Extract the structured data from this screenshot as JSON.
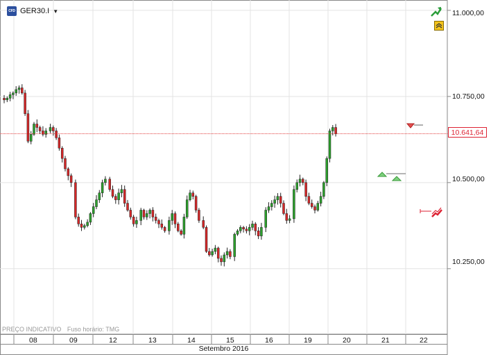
{
  "instrument": {
    "symbol": "GER30.I",
    "logo_text": "CFD",
    "dropdown_icon": "triangle-down-icon"
  },
  "info_bar": {
    "label": "PREÇO INDICATIVO",
    "timezone": "Fuso horário: TMG"
  },
  "current_price": {
    "label": "10.641,64",
    "value": 10641.64,
    "color": "#dd2222"
  },
  "month_label": "Setembro 2016",
  "icons": {
    "top_right": "green-trend-arrow-icon",
    "top_right_2": "yellow-collapse-icon",
    "right_mid": "red-signal-arrow-icon"
  },
  "chart_data": {
    "type": "candlestick",
    "x_tick_labels": [
      "08",
      "09",
      "12",
      "13",
      "14",
      "15",
      "16",
      "19",
      "20",
      "21",
      "22"
    ],
    "y_tick_labels": [
      "11.000,00",
      "10.750,00",
      "10.500,00",
      "10.250,00"
    ],
    "y_ticks": [
      11000,
      10750,
      10500,
      10250
    ],
    "ylim": [
      10060,
      11030
    ],
    "grid": true,
    "legend": "none",
    "up_color": "#2ca02c",
    "down_color": "#d62728",
    "session_closes": [
      [
        10740,
        10745,
        10755,
        10760,
        10770,
        10775,
        10760,
        10700,
        10620,
        10640,
        10670,
        10660,
        10650,
        10640,
        10650
      ],
      [
        10660,
        10650,
        10630,
        10600,
        10570,
        10540,
        10520,
        10500
      ],
      [
        10400,
        10380,
        10370,
        10375,
        10385,
        10410,
        10430,
        10450,
        10470,
        10500,
        10510
      ],
      [
        10480,
        10460,
        10450,
        10470,
        10480,
        10440,
        10420,
        10400,
        10380,
        10390
      ],
      [
        10420,
        10400,
        10410,
        10420,
        10400,
        10390,
        10380,
        10370,
        10360
      ],
      [
        10390,
        10410,
        10380,
        10360,
        10350,
        10400,
        10450,
        10470,
        10460,
        10420,
        10390
      ],
      [
        10370,
        10300,
        10290,
        10300,
        10310,
        10280,
        10270,
        10290,
        10300,
        10285
      ],
      [
        10350,
        10360,
        10370,
        10365,
        10360,
        10370,
        10380,
        10360,
        10345,
        10370
      ],
      [
        10420,
        10430,
        10440,
        10450,
        10460,
        10440,
        10410,
        10390,
        10395
      ],
      [
        10480,
        10500,
        10510,
        10500,
        10460,
        10440,
        10430,
        10420,
        10440,
        10460,
        10500,
        10570,
        10650,
        10660,
        10641.64
      ]
    ]
  }
}
